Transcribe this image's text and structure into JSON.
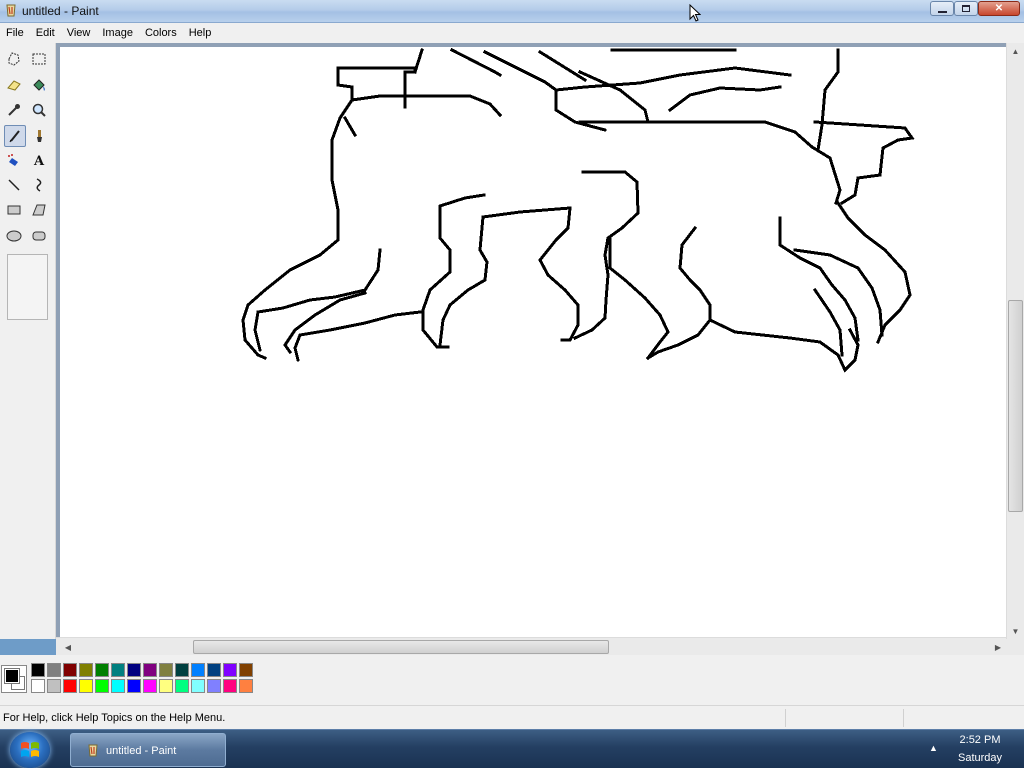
{
  "window": {
    "title": "untitled - Paint",
    "controls": {
      "minimize": "minimize-icon",
      "maximize": "maximize-icon",
      "close": "close-icon"
    }
  },
  "menu": {
    "items": [
      {
        "label": "File"
      },
      {
        "label": "Edit"
      },
      {
        "label": "View"
      },
      {
        "label": "Image"
      },
      {
        "label": "Colors"
      },
      {
        "label": "Help"
      }
    ]
  },
  "toolbox": {
    "tools": [
      {
        "name": "free-form-select",
        "icon": "free-select-icon"
      },
      {
        "name": "select",
        "icon": "rect-select-icon"
      },
      {
        "name": "eraser",
        "icon": "eraser-icon"
      },
      {
        "name": "fill-with-color",
        "icon": "paint-bucket-icon"
      },
      {
        "name": "pick-color",
        "icon": "eyedropper-icon"
      },
      {
        "name": "magnifier",
        "icon": "magnifier-icon"
      },
      {
        "name": "pencil",
        "icon": "pencil-icon",
        "active": true
      },
      {
        "name": "brush",
        "icon": "brush-icon"
      },
      {
        "name": "airbrush",
        "icon": "airbrush-icon"
      },
      {
        "name": "text",
        "icon": "text-icon"
      },
      {
        "name": "line",
        "icon": "line-icon"
      },
      {
        "name": "curve",
        "icon": "curve-icon"
      },
      {
        "name": "rectangle",
        "icon": "rectangle-icon"
      },
      {
        "name": "polygon",
        "icon": "polygon-icon"
      },
      {
        "name": "ellipse",
        "icon": "ellipse-icon"
      },
      {
        "name": "rounded-rectangle",
        "icon": "rounded-rect-icon"
      }
    ]
  },
  "palette": {
    "foreground": "#000000",
    "background": "#ffffff",
    "top_row": [
      "#000000",
      "#808080",
      "#800000",
      "#808000",
      "#008000",
      "#008080",
      "#000080",
      "#800080",
      "#808040",
      "#004040",
      "#0080ff",
      "#004080",
      "#8000ff",
      "#804000"
    ],
    "bottom_row": [
      "#ffffff",
      "#c0c0c0",
      "#ff0000",
      "#ffff00",
      "#00ff00",
      "#00ffff",
      "#0000ff",
      "#ff00ff",
      "#ffff80",
      "#00ff80",
      "#80ffff",
      "#8080ff",
      "#ff0080",
      "#ff8040"
    ]
  },
  "statusbar": {
    "text": "For Help, click Help Topics on the Help Menu."
  },
  "taskbar": {
    "start_icon": "windows-logo-icon",
    "task_label": "untitled - Paint",
    "tray_arrow": "▲",
    "clock_time": "2:52 PM",
    "clock_day": "Saturday"
  },
  "scrollbars": {
    "up": "▲",
    "down": "▼",
    "left": "◀",
    "right": "▶"
  }
}
